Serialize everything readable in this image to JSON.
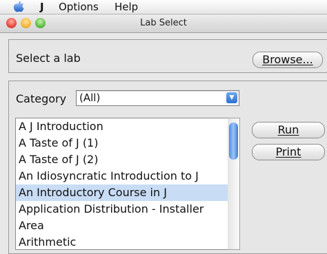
{
  "menubar": {
    "items": [
      "J",
      "Options",
      "Help"
    ]
  },
  "window": {
    "title": "Lab Select"
  },
  "select_lab": {
    "label": "Select a lab",
    "browse_label": "Browse..."
  },
  "category": {
    "label": "Category",
    "value": "(All)"
  },
  "labs": {
    "items": [
      "A J Introduction",
      "A Taste of J (1)",
      "A Taste of J (2)",
      "An Idiosyncratic Introduction to J",
      "An Introductory Course in J",
      "Application Distribution - Installer",
      "Area",
      "Arithmetic"
    ],
    "selected": "An Introductory Course in J"
  },
  "actions": {
    "run_label": "Run",
    "print_label": "Print"
  },
  "colors": {
    "selection": "#c8dcf5",
    "close": "#e8483f",
    "minimize": "#f5b83b",
    "zoom": "#5fbf45"
  }
}
